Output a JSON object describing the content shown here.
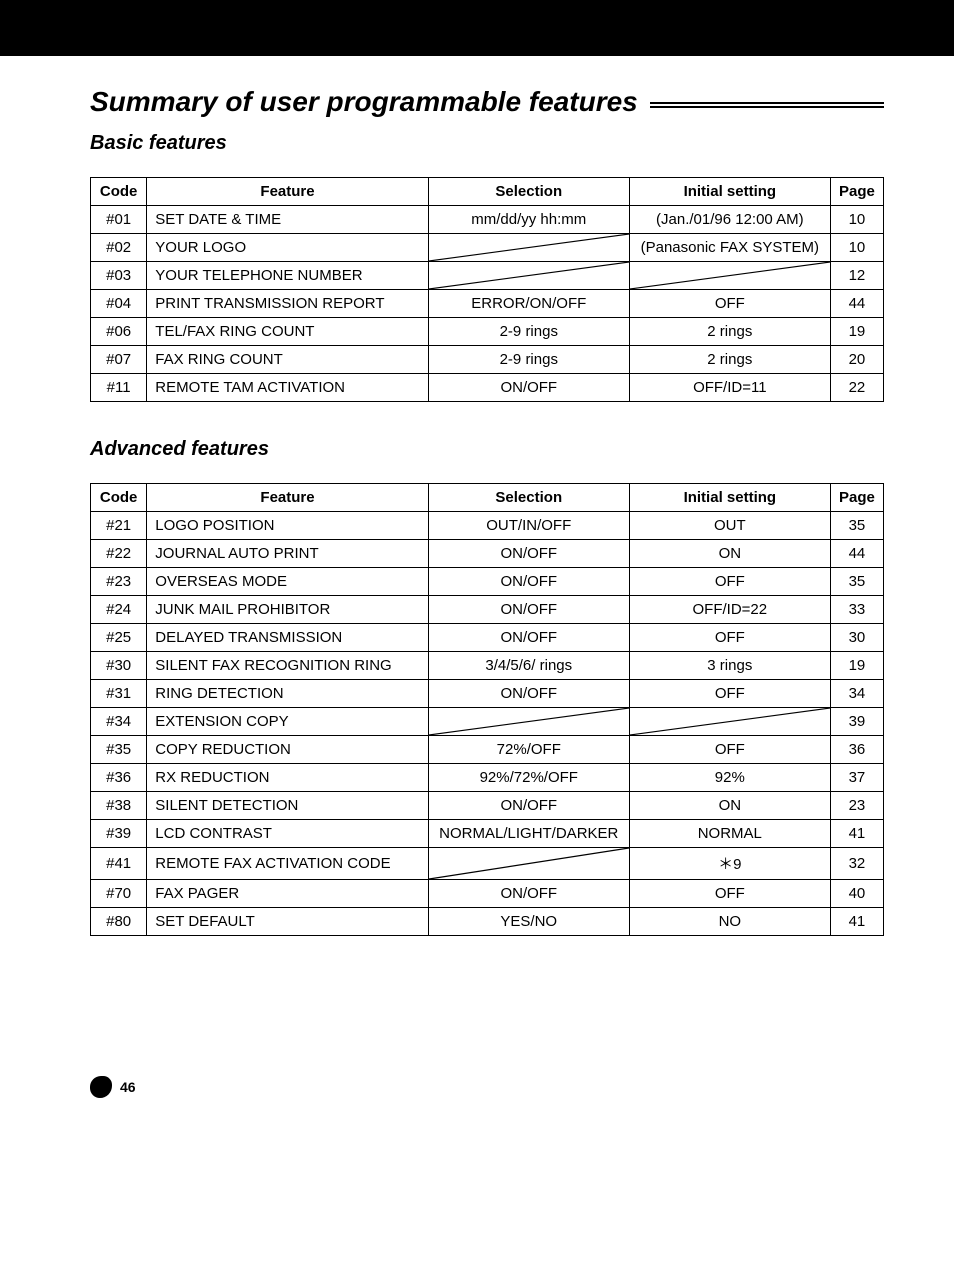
{
  "title": "Summary of user programmable features",
  "page_number": "46",
  "columns": {
    "code": "Code",
    "feature": "Feature",
    "selection": "Selection",
    "initial": "Initial setting",
    "page": "Page"
  },
  "basic": {
    "heading": "Basic features",
    "rows": [
      {
        "code": "#01",
        "feature": "SET DATE & TIME",
        "selection": "mm/dd/yy hh:mm",
        "initial": "(Jan./01/96 12:00 AM)",
        "page": "10"
      },
      {
        "code": "#02",
        "feature": "YOUR LOGO",
        "selection": "__slash__",
        "initial": "(Panasonic FAX SYSTEM)",
        "page": "10"
      },
      {
        "code": "#03",
        "feature": "YOUR TELEPHONE NUMBER",
        "selection": "__slash__",
        "initial": "__slash__",
        "page": "12"
      },
      {
        "code": "#04",
        "feature": "PRINT TRANSMISSION REPORT",
        "selection": "ERROR/ON/OFF",
        "initial": "OFF",
        "page": "44"
      },
      {
        "code": "#06",
        "feature": "TEL/FAX RING COUNT",
        "selection": "2-9 rings",
        "initial": "2 rings",
        "page": "19"
      },
      {
        "code": "#07",
        "feature": "FAX RING COUNT",
        "selection": "2-9 rings",
        "initial": "2 rings",
        "page": "20"
      },
      {
        "code": "#11",
        "feature": "REMOTE TAM ACTIVATION",
        "selection": "ON/OFF",
        "initial": "OFF/ID=11",
        "page": "22"
      }
    ]
  },
  "advanced": {
    "heading": "Advanced features",
    "rows": [
      {
        "code": "#21",
        "feature": "LOGO POSITION",
        "selection": "OUT/IN/OFF",
        "initial": "OUT",
        "page": "35"
      },
      {
        "code": "#22",
        "feature": "JOURNAL AUTO PRINT",
        "selection": "ON/OFF",
        "initial": "ON",
        "page": "44"
      },
      {
        "code": "#23",
        "feature": "OVERSEAS MODE",
        "selection": "ON/OFF",
        "initial": "OFF",
        "page": "35"
      },
      {
        "code": "#24",
        "feature": "JUNK MAIL PROHIBITOR",
        "selection": "ON/OFF",
        "initial": "OFF/ID=22",
        "page": "33"
      },
      {
        "code": "#25",
        "feature": "DELAYED TRANSMISSION",
        "selection": "ON/OFF",
        "initial": "OFF",
        "page": "30"
      },
      {
        "code": "#30",
        "feature": "SILENT FAX RECOGNITION RING",
        "selection": "3/4/5/6/ rings",
        "initial": "3 rings",
        "page": "19"
      },
      {
        "code": "#31",
        "feature": "RING DETECTION",
        "selection": "ON/OFF",
        "initial": "OFF",
        "page": "34"
      },
      {
        "code": "#34",
        "feature": "EXTENSION COPY",
        "selection": "__slash__",
        "initial": "__slash__",
        "page": "39"
      },
      {
        "code": "#35",
        "feature": "COPY REDUCTION",
        "selection": "72%/OFF",
        "initial": "OFF",
        "page": "36"
      },
      {
        "code": "#36",
        "feature": "RX REDUCTION",
        "selection": "92%/72%/OFF",
        "initial": "92%",
        "page": "37"
      },
      {
        "code": "#38",
        "feature": "SILENT DETECTION",
        "selection": "ON/OFF",
        "initial": "ON",
        "page": "23"
      },
      {
        "code": "#39",
        "feature": "LCD CONTRAST",
        "selection": "NORMAL/LIGHT/DARKER",
        "initial": "NORMAL",
        "page": "41"
      },
      {
        "code": "#41",
        "feature": "REMOTE FAX ACTIVATION CODE",
        "selection": "__slash__",
        "initial": "＊9",
        "page": "32"
      },
      {
        "code": "#70",
        "feature": "FAX PAGER",
        "selection": "ON/OFF",
        "initial": "OFF",
        "page": "40"
      },
      {
        "code": "#80",
        "feature": "SET DEFAULT",
        "selection": "YES/NO",
        "initial": "NO",
        "page": "41"
      }
    ]
  }
}
